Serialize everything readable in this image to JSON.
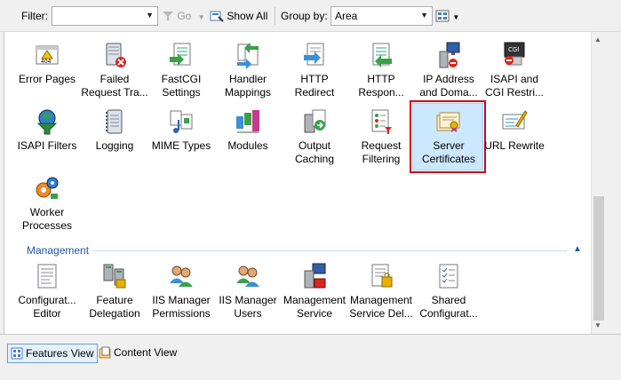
{
  "toolbar": {
    "filter_label": "Filter:",
    "filter_value": "",
    "go_label": "Go",
    "show_all_label": "Show All",
    "group_by_label": "Group by:",
    "group_by_value": "Area"
  },
  "features": [
    {
      "label": "Error Pages",
      "icon": "error-pages-icon"
    },
    {
      "label": "Failed\nRequest Tra...",
      "icon": "failed-request-tracing-icon"
    },
    {
      "label": "FastCGI\nSettings",
      "icon": "fastcgi-settings-icon"
    },
    {
      "label": "Handler\nMappings",
      "icon": "handler-mappings-icon"
    },
    {
      "label": "HTTP\nRedirect",
      "icon": "http-redirect-icon"
    },
    {
      "label": "HTTP\nRespon...",
      "icon": "http-response-headers-icon"
    },
    {
      "label": "IP Address\nand Doma...",
      "icon": "ip-address-icon"
    },
    {
      "label": "ISAPI and\nCGI Restri...",
      "icon": "isapi-cgi-icon"
    },
    {
      "label": "ISAPI Filters",
      "icon": "isapi-filters-icon"
    },
    {
      "label": "Logging",
      "icon": "logging-icon"
    },
    {
      "label": "MIME Types",
      "icon": "mime-types-icon"
    },
    {
      "label": "Modules",
      "icon": "modules-icon"
    },
    {
      "label": "Output\nCaching",
      "icon": "output-caching-icon"
    },
    {
      "label": "Request\nFiltering",
      "icon": "request-filtering-icon"
    },
    {
      "label": "Server\nCertificates",
      "icon": "server-certificates-icon",
      "selected": true
    },
    {
      "label": "URL Rewrite",
      "icon": "url-rewrite-icon"
    },
    {
      "label": "Worker\nProcesses",
      "icon": "worker-processes-icon"
    }
  ],
  "management": {
    "group_label": "Management",
    "items": [
      {
        "label": "Configurat...\nEditor",
        "icon": "configuration-editor-icon"
      },
      {
        "label": "Feature\nDelegation",
        "icon": "feature-delegation-icon"
      },
      {
        "label": "IIS Manager\nPermissions",
        "icon": "iis-manager-permissions-icon"
      },
      {
        "label": "IIS Manager\nUsers",
        "icon": "iis-manager-users-icon"
      },
      {
        "label": "Management\nService",
        "icon": "management-service-icon"
      },
      {
        "label": "Management\nService Del...",
        "icon": "management-service-delegation-icon"
      },
      {
        "label": "Shared\nConfigurat...",
        "icon": "shared-configuration-icon"
      }
    ]
  },
  "views": {
    "features_view": "Features View",
    "content_view": "Content View"
  }
}
